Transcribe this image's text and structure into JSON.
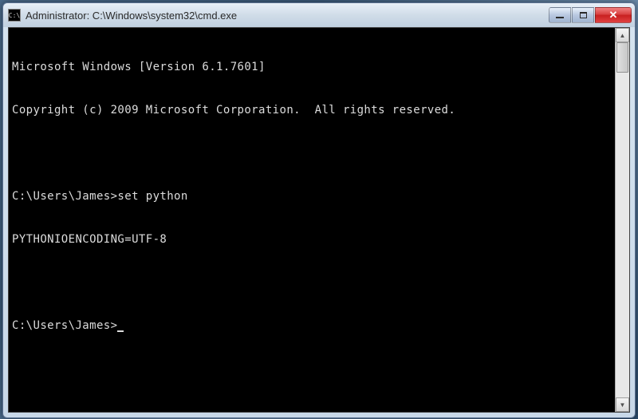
{
  "window": {
    "title": "Administrator: C:\\Windows\\system32\\cmd.exe",
    "icon_label": "C:\\"
  },
  "terminal": {
    "lines": [
      "Microsoft Windows [Version 6.1.7601]",
      "Copyright (c) 2009 Microsoft Corporation.  All rights reserved.",
      "",
      "C:\\Users\\James>set python",
      "PYTHONIOENCODING=UTF-8",
      "",
      "C:\\Users\\James>"
    ]
  },
  "scrollbar": {
    "up": "▲",
    "down": "▼"
  }
}
